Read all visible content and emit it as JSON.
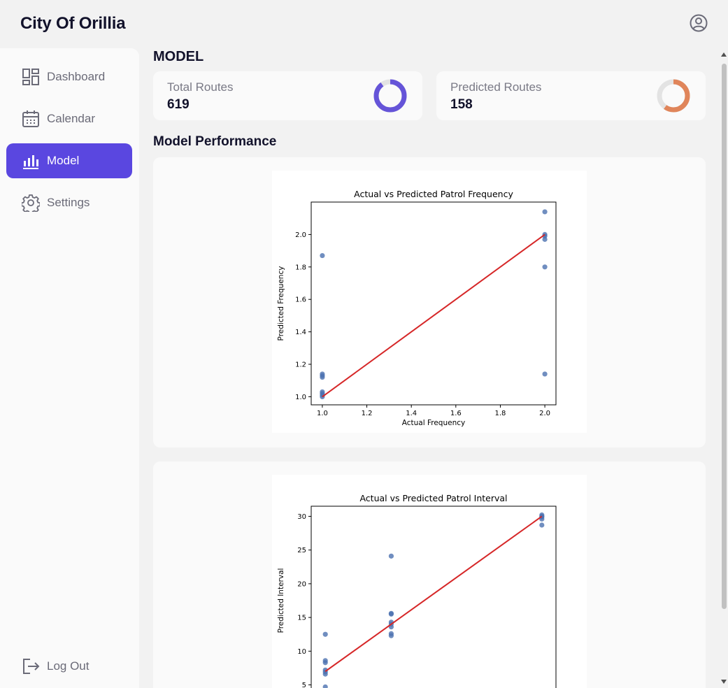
{
  "app": {
    "title": "City Of Orillia"
  },
  "header": {
    "user_icon": "user-circle-icon"
  },
  "sidebar": {
    "items": [
      {
        "label": "Dashboard",
        "icon": "dashboard-icon",
        "active": false
      },
      {
        "label": "Calendar",
        "icon": "calendar-icon",
        "active": false
      },
      {
        "label": "Model",
        "icon": "bar-chart-icon",
        "active": true
      },
      {
        "label": "Settings",
        "icon": "gear-icon",
        "active": false
      }
    ],
    "logout": {
      "label": "Log Out",
      "icon": "logout-icon"
    }
  },
  "main": {
    "title": "MODEL",
    "stats": [
      {
        "label": "Total Routes",
        "value": "619",
        "ring_color": "#6554d8",
        "ring_fill": 0.9
      },
      {
        "label": "Predicted Routes",
        "value": "158",
        "ring_color": "#e0855a",
        "ring_fill": 0.6
      }
    ],
    "section_title": "Model Performance"
  },
  "colors": {
    "accent": "#5a47e0",
    "point": "#4c72b0",
    "fit_line": "#d62728"
  },
  "chart_data": [
    {
      "type": "scatter",
      "title": "Actual vs Predicted Patrol Frequency",
      "xlabel": "Actual Frequency",
      "ylabel": "Predicted Frequency",
      "xlim": [
        0.95,
        2.05
      ],
      "ylim": [
        0.95,
        2.2
      ],
      "xticks": [
        "1.0",
        "1.2",
        "1.4",
        "1.6",
        "1.8",
        "2.0"
      ],
      "yticks": [
        "1.0",
        "1.2",
        "1.4",
        "1.6",
        "1.8",
        "2.0"
      ],
      "points": [
        [
          1.0,
          1.87
        ],
        [
          1.0,
          1.14
        ],
        [
          1.0,
          1.13
        ],
        [
          1.0,
          1.12
        ],
        [
          1.0,
          1.03
        ],
        [
          1.0,
          1.02
        ],
        [
          1.0,
          1.01
        ],
        [
          1.0,
          1.0
        ],
        [
          2.0,
          2.14
        ],
        [
          2.0,
          2.0
        ],
        [
          2.0,
          1.99
        ],
        [
          2.0,
          1.97
        ],
        [
          2.0,
          1.8
        ],
        [
          2.0,
          1.14
        ]
      ],
      "fit_line": [
        [
          1.0,
          1.0
        ],
        [
          2.0,
          2.0
        ]
      ]
    },
    {
      "type": "scatter",
      "title": "Actual vs Predicted Patrol Interval",
      "xlabel": "",
      "ylabel": "Predicted Interval",
      "xlim": [
        5.5,
        31.5
      ],
      "ylim": [
        3.5,
        31.5
      ],
      "yticks": [
        "5",
        "10",
        "15",
        "20",
        "25",
        "30"
      ],
      "points": [
        [
          7,
          12.5
        ],
        [
          7,
          8.6
        ],
        [
          7,
          8.3
        ],
        [
          7,
          7.2
        ],
        [
          7,
          6.9
        ],
        [
          7,
          6.6
        ],
        [
          7,
          4.7
        ],
        [
          14,
          24.1
        ],
        [
          14,
          15.6
        ],
        [
          14,
          15.5
        ],
        [
          14,
          14.3
        ],
        [
          14,
          14.0
        ],
        [
          14,
          13.6
        ],
        [
          14,
          12.6
        ],
        [
          14,
          12.3
        ],
        [
          30,
          30.2
        ],
        [
          30,
          30.0
        ],
        [
          30,
          29.9
        ],
        [
          30,
          29.6
        ],
        [
          30,
          28.7
        ]
      ],
      "fit_line": [
        [
          7,
          7
        ],
        [
          30,
          30
        ]
      ]
    }
  ]
}
